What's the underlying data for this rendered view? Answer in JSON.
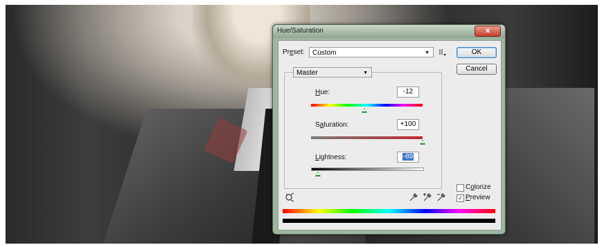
{
  "dialog": {
    "title": "Hue/Saturation",
    "close_symbol": "x"
  },
  "preset": {
    "label_pre": "Pr",
    "label_u": "e",
    "label_post": "set:",
    "value": "Custom",
    "options_icon": "menu-options-icon"
  },
  "buttons": {
    "ok": "OK",
    "cancel": "Cancel"
  },
  "channel": {
    "value": "Master"
  },
  "hue": {
    "label_u": "H",
    "label_rest": "ue:",
    "value": "-12",
    "slider_position": 0.47
  },
  "saturation": {
    "label_pre": "S",
    "label_u": "a",
    "label_rest": "turation:",
    "value": "+100",
    "slider_position": 1.0
  },
  "lightness": {
    "label_u": "L",
    "label_rest": "ightness:",
    "value": "-89",
    "slider_position": 0.06
  },
  "colorize": {
    "label_pre": "C",
    "label_u": "o",
    "label_rest": "lorize",
    "checked": false
  },
  "preview": {
    "label_u": "P",
    "label_rest": "review",
    "checked": true,
    "check_symbol": "✓"
  },
  "icons": {
    "adjust_tool": "targeted-adjustment-icon",
    "eyedropper": "eyedropper-icon",
    "eyedropper_plus": "eyedropper-plus-icon",
    "eyedropper_minus": "eyedropper-minus-icon"
  },
  "colors": {
    "accent": "#3a74c8",
    "saturation_bar": "#c0282e",
    "slider_thumb": "#2e8a3a"
  }
}
